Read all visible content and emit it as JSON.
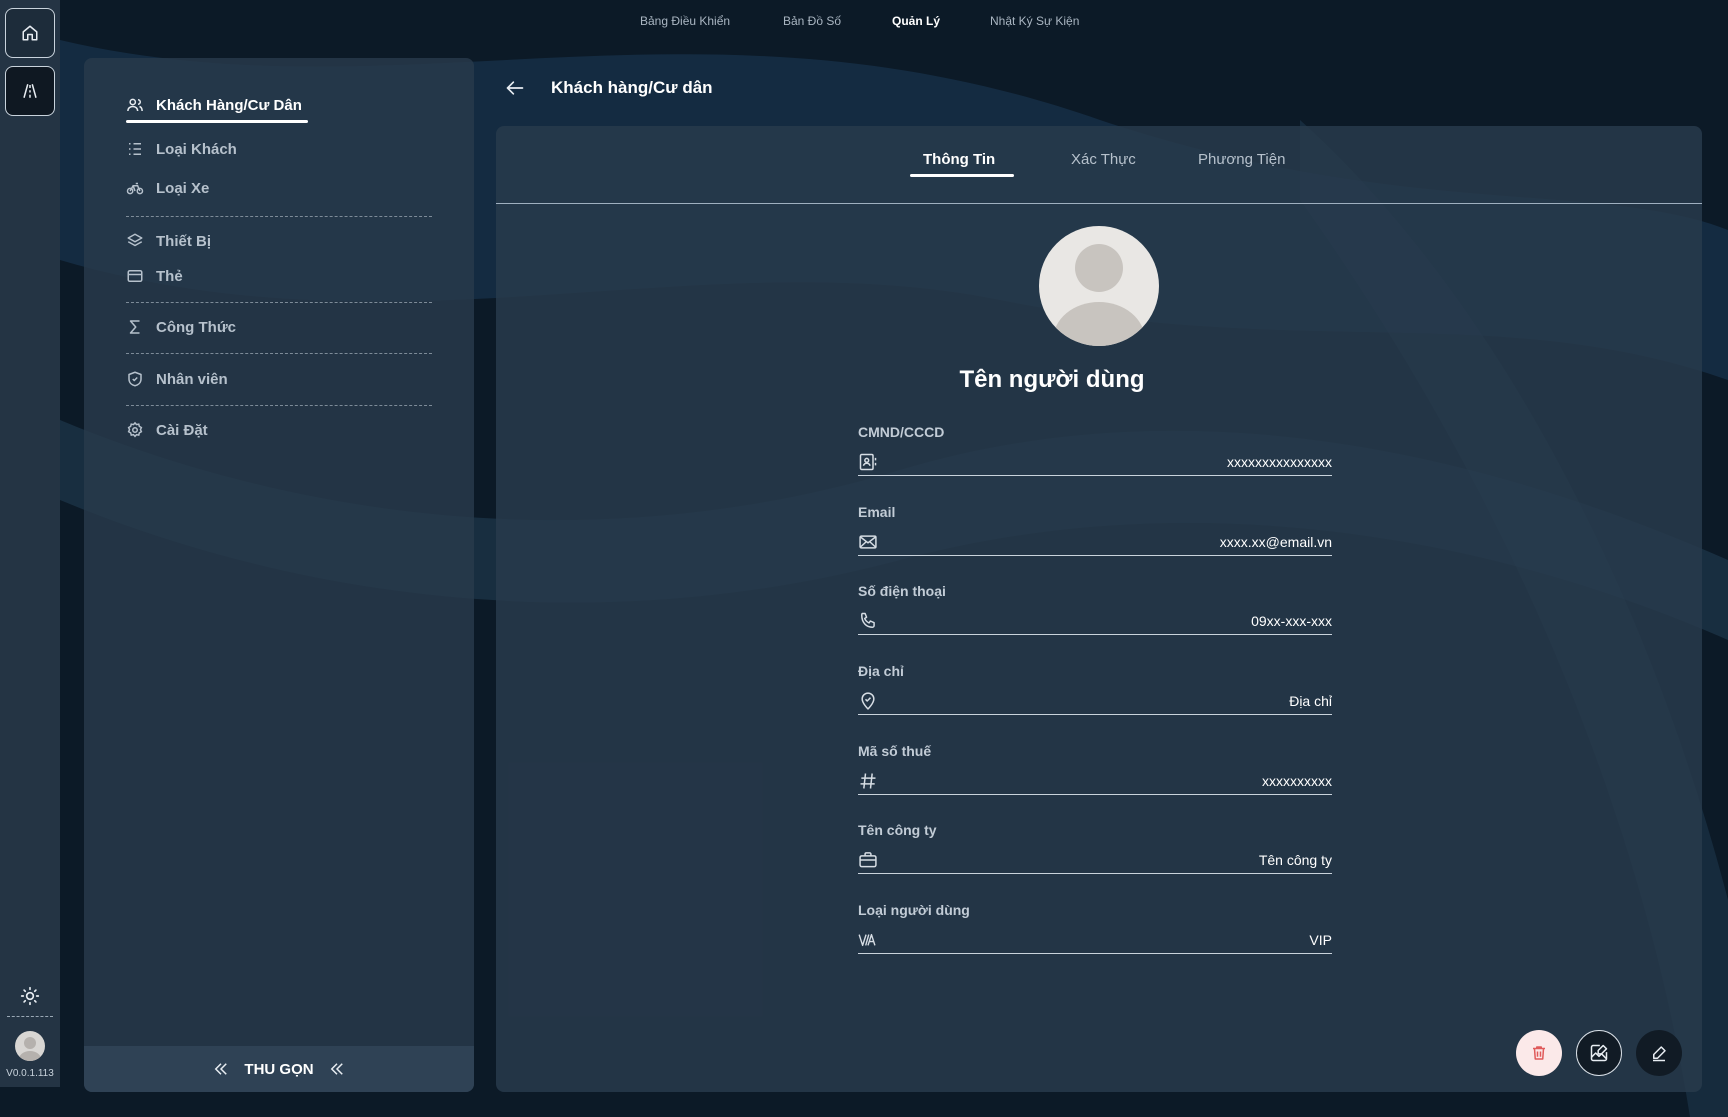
{
  "topnav": {
    "items": [
      {
        "label": "Bảng Điều Khiển",
        "active": false
      },
      {
        "label": "Bản Đồ Số",
        "active": false
      },
      {
        "label": "Quản Lý",
        "active": true
      },
      {
        "label": "Nhật Ký Sự Kiện",
        "active": false
      }
    ]
  },
  "rail": {
    "buttons": [
      "home-icon",
      "map-icon"
    ],
    "theme_icon": "sun-icon",
    "version": "V0.0.1.113"
  },
  "sidebar": {
    "items": [
      {
        "label": "Khách Hàng/Cư Dân",
        "icon": "users-icon",
        "active": true
      },
      {
        "label": "Loại Khách",
        "icon": "list-icon",
        "active": false
      },
      {
        "label": "Loại Xe",
        "icon": "bike-icon",
        "active": false
      },
      {
        "label": "Thiết Bị",
        "icon": "layers-icon",
        "active": false
      },
      {
        "label": "Thẻ",
        "icon": "card-icon",
        "active": false
      },
      {
        "label": "Công Thức",
        "icon": "sigma-icon",
        "active": false
      },
      {
        "label": "Nhân viên",
        "icon": "shield-icon",
        "active": false
      },
      {
        "label": "Cài Đặt",
        "icon": "gear-icon",
        "active": false
      }
    ],
    "collapse_label": "THU GỌN"
  },
  "page": {
    "title": "Khách hàng/Cư dân"
  },
  "tabs": [
    {
      "label": "Thông Tin",
      "active": true
    },
    {
      "label": "Xác Thực",
      "active": false
    },
    {
      "label": "Phương Tiện",
      "active": false
    }
  ],
  "profile": {
    "name": "Tên người dùng",
    "fields": [
      {
        "label": "CMND/CCCD",
        "value": "xxxxxxxxxxxxxxx",
        "icon": "id-card-icon"
      },
      {
        "label": "Email",
        "value": "xxxx.xx@email.vn",
        "icon": "mail-icon"
      },
      {
        "label": "Số điện thoại",
        "value": "09xx-xxx-xxx",
        "icon": "phone-icon"
      },
      {
        "label": "Địa chỉ",
        "value": "Địa chỉ",
        "icon": "location-icon"
      },
      {
        "label": "Mã số thuế",
        "value": "xxxxxxxxxx",
        "icon": "hash-icon"
      },
      {
        "label": "Tên công ty",
        "value": "Tên công ty",
        "icon": "briefcase-icon"
      },
      {
        "label": "Loại người dùng",
        "value": "VIP",
        "icon": "va-icon"
      }
    ]
  },
  "actions": [
    "trash-icon",
    "image-edit-icon",
    "pencil-icon"
  ],
  "colors": {
    "background": "#0c1a27",
    "panel": "#283a4c",
    "rail": "#243444",
    "delete_button": "#fbe9e9",
    "delete_icon": "#e05a5a"
  }
}
